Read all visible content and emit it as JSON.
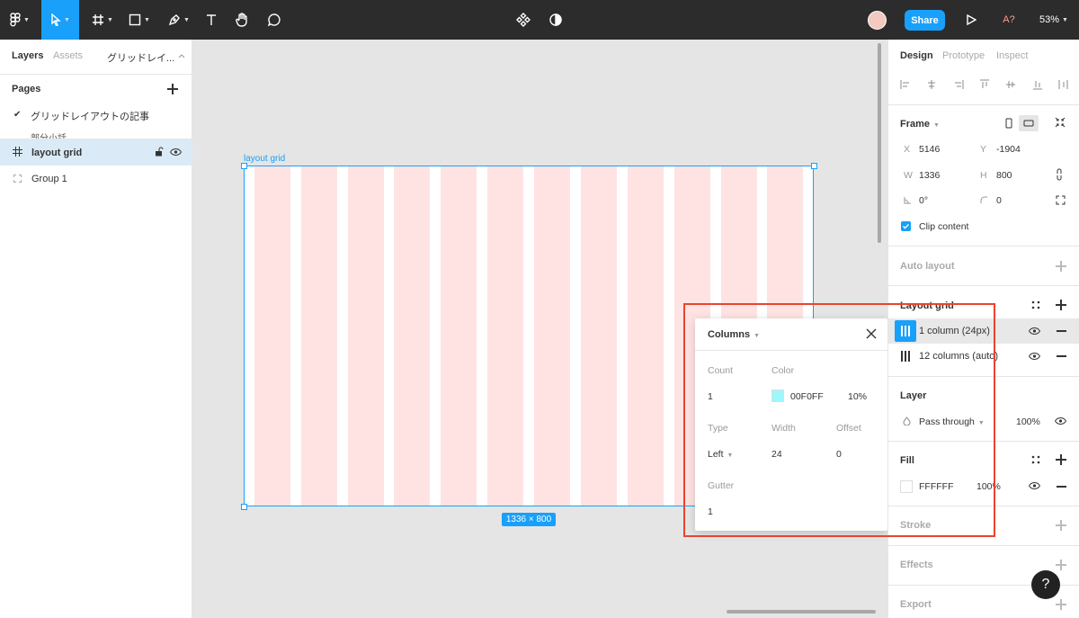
{
  "toolbar": {
    "share_label": "Share",
    "zoom": "53%",
    "font_missing": "A?"
  },
  "left_panel": {
    "tabs": [
      "Layers",
      "Assets",
      "グリッドレイ..."
    ],
    "pages_title": "Pages",
    "pages": [
      "グリッドレイアウトの記事",
      "部分小話"
    ],
    "layers": [
      {
        "label": "layout grid"
      },
      {
        "label": "Group 1"
      }
    ]
  },
  "canvas": {
    "frame_label": "layout grid",
    "size_badge": "1336 × 800"
  },
  "popup": {
    "title": "Columns",
    "count_label": "Count",
    "count": "1",
    "color_label": "Color",
    "color_hex": "00F0FF",
    "color_opacity": "10%",
    "type_label": "Type",
    "type_value": "Left",
    "width_label": "Width",
    "width_value": "24",
    "offset_label": "Offset",
    "offset_value": "0",
    "gutter_label": "Gutter",
    "gutter_value": "1"
  },
  "right_panel": {
    "tabs": [
      "Design",
      "Prototype",
      "Inspect"
    ],
    "frame": {
      "title": "Frame",
      "x_label": "X",
      "x": "5146",
      "y_label": "Y",
      "y": "-1904",
      "w_label": "W",
      "w": "1336",
      "h_label": "H",
      "h": "800",
      "rotation": "0°",
      "radius": "0",
      "clip_label": "Clip content"
    },
    "auto_layout": "Auto layout",
    "layout_grid": {
      "title": "Layout grid",
      "items": [
        "1 column (24px)",
        "12 columns (auto)"
      ]
    },
    "layer": {
      "title": "Layer",
      "blend": "Pass through",
      "opacity": "100%"
    },
    "fill": {
      "title": "Fill",
      "hex": "FFFFFF",
      "opacity": "100%"
    },
    "stroke": "Stroke",
    "effects": "Effects",
    "export": "Export"
  },
  "colors": {
    "accent": "#18a0fb",
    "toolbar_bg": "#2c2c2c",
    "grid_column": "#ffe3e3",
    "highlight_box": "#e8452e"
  }
}
